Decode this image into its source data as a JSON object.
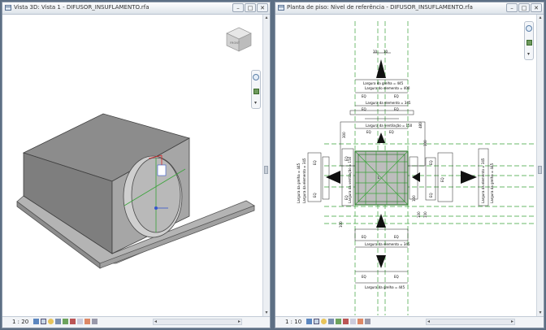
{
  "left_window": {
    "title": "Vista 3D: Vista 1 - DIFUSOR_INSUFLAMENTO.rfa",
    "scale": "1 : 20",
    "viewcube_face": "FRONT"
  },
  "right_window": {
    "title": "Planta de piso: Nivel de referência - DIFUSOR_INSUFLAMENTO.rfa",
    "scale": "1 : 10",
    "dims": {
      "d10a": "10",
      "d10b": "10",
      "lbl_top1": "Largura da grelha = 445",
      "lbl_top2": "Largura do elemento = 400",
      "lbl_top3": "Largura da elemento = 345",
      "lbl_top4": "Largura da ventilação = 150",
      "lbl_bot1": "Largura da elemento = 345",
      "lbl_bot2": "Largura da grelha = 445",
      "eq": "EQ",
      "v300": "300",
      "v480": "480",
      "v100a": "100",
      "v100b": "100",
      "v100c": "100",
      "v100d": "100",
      "v100e": "100",
      "lbl_left1": "Largura da grelha = 445",
      "lbl_left2": "Largura da elemento = 345",
      "lbl_left3": "Largura da ventilação = 150",
      "lbl_right1": "Largura da elemento = 345",
      "lbl_right2": "Largura da grelha = 445",
      "l_small": "L"
    }
  },
  "colors": {
    "accent_green": "#3aa33a",
    "block_gray": "#9a9a9a"
  },
  "icons": {
    "window_icon": "revit-view-icon",
    "minimize": "minimize-icon",
    "maximize": "maximize-icon",
    "close": "close-icon",
    "nav_wheel": "steering-wheel-icon",
    "zoom": "zoom-icon"
  },
  "buttons": {
    "minimize": "–",
    "maximize": "□",
    "close": "✕"
  }
}
